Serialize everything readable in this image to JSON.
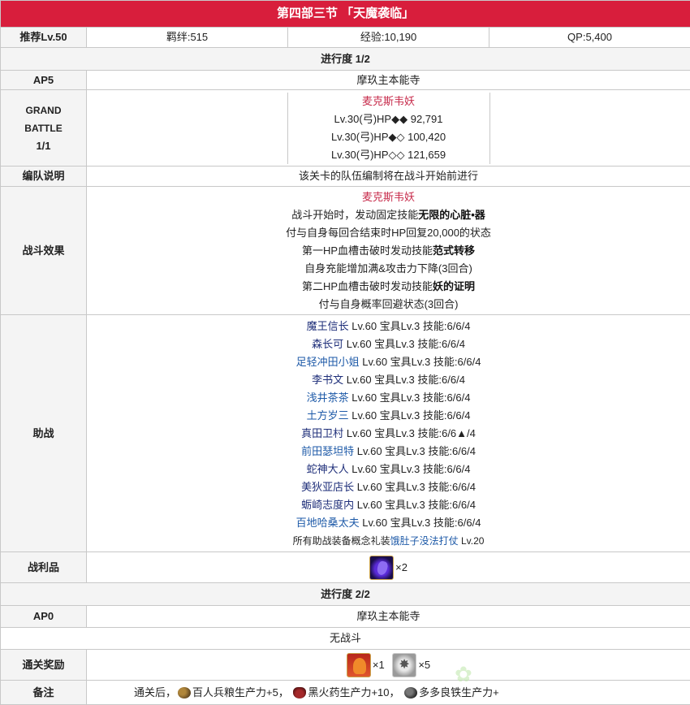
{
  "title": "第四部三节 「天魔袭临」",
  "header": {
    "recommend": "推荐Lv.50",
    "bond": "羁绊:515",
    "exp": "经验:10,190",
    "qp": "QP:5,400"
  },
  "progress1": {
    "label": "进行度 1/2"
  },
  "ap1": {
    "label": "AP5",
    "location": "摩玖主本能寺"
  },
  "battle": {
    "label_line1": "GRAND",
    "label_line2": "BATTLE",
    "label_line3": "1/1",
    "enemy_name": "麦克斯韦妖",
    "enemies": [
      "Lv.30(弓)HP◆◆ 92,791",
      "Lv.30(弓)HP◆◇ 100,420",
      "Lv.30(弓)HP◇◇ 121,659"
    ]
  },
  "formation": {
    "label": "编队说明",
    "text": "该关卡的队伍编制将在战斗开始前进行"
  },
  "effects": {
    "label": "战斗效果",
    "name": "麦克斯韦妖",
    "l1_pre": "战斗开始时，发动固定技能",
    "l1_bold": "无限的心脏•器",
    "l2": "付与自身每回合结束时HP回复20,000的状态",
    "l3_pre": "第一HP血槽击破时发动技能",
    "l3_bold": "范式转移",
    "l4": "自身充能增加满&攻击力下降(3回合)",
    "l5_pre": "第二HP血槽击破时发动技能",
    "l5_bold": "妖的证明",
    "l6": "付与自身概率回避状态(3回合)"
  },
  "support": {
    "label": "助战",
    "rows": [
      {
        "name": "魔王信长",
        "stats": "Lv.60 宝具Lv.3 技能:6/6/4",
        "color": "navy"
      },
      {
        "name": "森长可",
        "stats": "Lv.60 宝具Lv.3 技能:6/6/4",
        "color": "navy"
      },
      {
        "name": "足轻冲田小姐",
        "stats": "Lv.60 宝具Lv.3 技能:6/6/4",
        "color": "blue"
      },
      {
        "name": "李书文",
        "stats": "Lv.60 宝具Lv.3 技能:6/6/4",
        "color": "navy"
      },
      {
        "name": "浅井茶茶",
        "stats": "Lv.60 宝具Lv.3 技能:6/6/4",
        "color": "blue"
      },
      {
        "name": "土方岁三",
        "stats": "Lv.60 宝具Lv.3 技能:6/6/4",
        "color": "blue"
      },
      {
        "name": "真田卫村",
        "stats": "Lv.60 宝具Lv.3 技能:6/6▲/4",
        "color": "navy"
      },
      {
        "name": "前田瑟坦特",
        "stats": "Lv.60 宝具Lv.3 技能:6/6/4",
        "color": "blue"
      },
      {
        "name": "蛇神大人",
        "stats": "Lv.60 宝具Lv.3 技能:6/6/4",
        "color": "navy"
      },
      {
        "name": "美狄亚店长",
        "stats": "Lv.60 宝具Lv.3 技能:6/6/4",
        "color": "navy"
      },
      {
        "name": "蛎崎志度内",
        "stats": "Lv.60 宝具Lv.3 技能:6/6/4",
        "color": "navy"
      },
      {
        "name": "百地哈桑太夫",
        "stats": "Lv.60 宝具Lv.3 技能:6/6/4",
        "color": "blue"
      }
    ],
    "note_pre": "所有助战装备概念礼装",
    "note_link": "饿肚子没法打仗",
    "note_post": " Lv.20"
  },
  "loot": {
    "label": "战利品",
    "count": "×2",
    "icon": "purple-gem-icon"
  },
  "progress2": {
    "label": "进行度 2/2"
  },
  "ap2": {
    "label": "AP0",
    "location": "摩玖主本能寺"
  },
  "nobattle": {
    "text": "无战斗"
  },
  "reward": {
    "label": "通关奖励",
    "count1": "×1",
    "count2": "×5",
    "icon1": "craft-essence-card-icon",
    "icon2": "silver-material-icon"
  },
  "remarks": {
    "label": "备注",
    "pre": "通关后，",
    "item1": "百人兵粮生产力+5，",
    "item2": "黑火药生产力+10，",
    "item3": "多多良铁生产力+"
  },
  "colors": {
    "title_bg": "#d81e3c",
    "enemy_name": "#c72b4b",
    "link": "#1e5aa8"
  }
}
